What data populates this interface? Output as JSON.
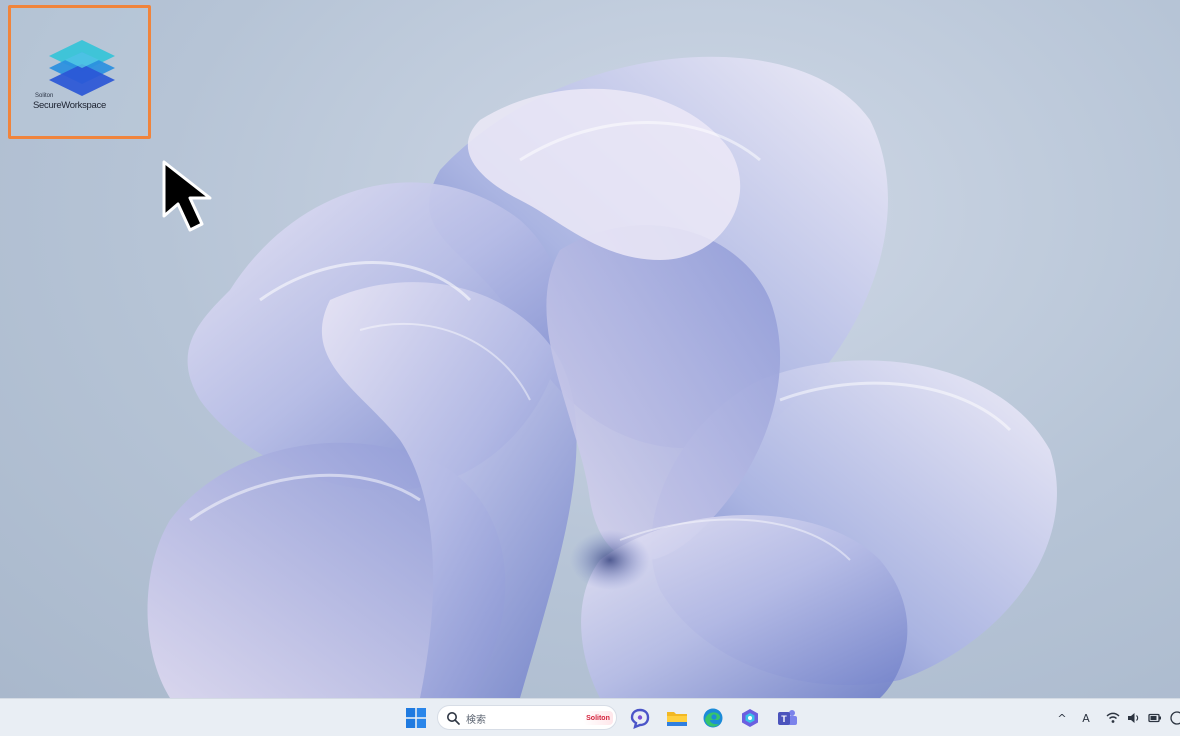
{
  "desktop": {
    "shortcut": {
      "vendor": "Soliton",
      "name": "SecureWorkspace",
      "highlight_color": "#f0843c"
    }
  },
  "taskbar": {
    "search": {
      "label": "検索",
      "badge": "Soliton"
    },
    "apps": [
      {
        "name": "start-icon"
      },
      {
        "name": "copilot-icon"
      },
      {
        "name": "file-explorer-icon"
      },
      {
        "name": "edge-icon"
      },
      {
        "name": "app-icon"
      },
      {
        "name": "teams-icon"
      }
    ],
    "tray": {
      "chevron": "^",
      "ime": "A"
    }
  },
  "colors": {
    "accent": "#f0843c",
    "taskbar_bg": "#e9eef4"
  }
}
